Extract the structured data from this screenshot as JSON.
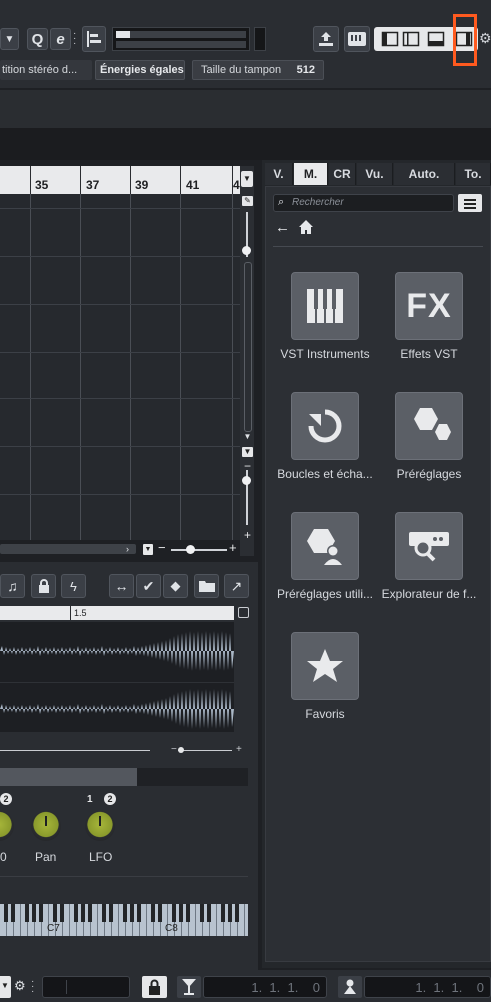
{
  "toolbar": {
    "stereo_split_label": "tition stéréo d...",
    "equal_energy_label": "Énergies égales",
    "buffer_size_label": "Taille du tampon",
    "buffer_size_value": "512"
  },
  "ruler": {
    "bar_numbers": [
      "35",
      "37",
      "39",
      "41",
      "4"
    ]
  },
  "right_zone": {
    "tabs": [
      "V.",
      "M.",
      "CR",
      "Vu.",
      "Auto.",
      "To."
    ],
    "active_tab": "M.",
    "search": {
      "placeholder": "Rechercher"
    },
    "tiles": [
      {
        "label": "VST Instruments",
        "icon": "piano-keys-icon"
      },
      {
        "label": "Effets VST",
        "icon": "fx-icon"
      },
      {
        "label": "Boucles et écha...",
        "icon": "loop-icon"
      },
      {
        "label": "Préréglages",
        "icon": "hexagons-icon"
      },
      {
        "label": "Préréglages utili...",
        "icon": "user-preset-icon"
      },
      {
        "label": "Explorateur de f...",
        "icon": "file-explorer-icon"
      },
      {
        "label": "Favoris",
        "icon": "star-icon"
      }
    ]
  },
  "lower_zone": {
    "ruler_mark": "1.5",
    "knobs": [
      {
        "label": "Pan",
        "badge": ""
      },
      {
        "label": "LFO",
        "badges": [
          "1",
          "2"
        ]
      }
    ],
    "partial_knob_label": "0",
    "badge_left": "2",
    "keyboard_labels": [
      "C7",
      "C8"
    ]
  },
  "status_bar": {
    "position_left": "1.  1.  1.    0",
    "position_right": "1.  1.  1.    0"
  },
  "colors": {
    "highlight": "#ff5a1f",
    "knob": "#98a832",
    "waveform": "#aab7c6"
  }
}
